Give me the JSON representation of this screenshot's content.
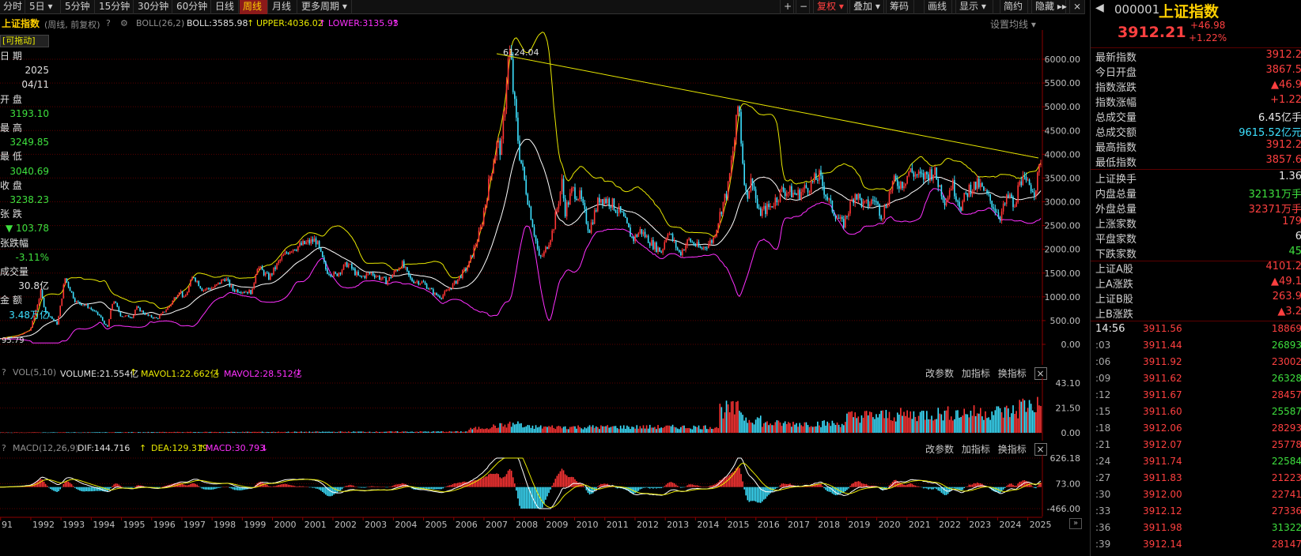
{
  "toolbar": {
    "periods": [
      "分时",
      "5日 ▾",
      "5分钟",
      "15分钟",
      "30分钟",
      "60分钟",
      "日线",
      "周线",
      "月线",
      "更多周期 ▾"
    ],
    "active_period": "周线",
    "right_buttons": [
      "+",
      "−",
      "复权 ▾",
      "叠加 ▾",
      "筹码",
      "画线",
      "显示 ▾",
      "简约",
      "隐藏 ▸▸"
    ]
  },
  "chart_header": {
    "title": "上证指数",
    "subtitle": "(周线, 前复权)",
    "indicator": "BOLL(26,2)",
    "boll": "BOLL:3585.98",
    "upper": "UPPER:4036.02",
    "lower": "LOWER:3135.93",
    "settings": "设置均线 ▾"
  },
  "info_panel": {
    "badge": "[可拖动]",
    "date_label": "日 期",
    "year": "2025",
    "date": "04/11",
    "open_label": "开 盘",
    "open": "3193.10",
    "high_label": "最 高",
    "high": "3249.85",
    "low_label": "最 低",
    "low": "3040.69",
    "close_label": "收 盘",
    "close": "3238.23",
    "change_label": "张 跌",
    "change": "▼ 103.78",
    "pct_label": "张跌幅",
    "pct": "-3.11%",
    "vol_label": "成交量",
    "vol": "30.8亿",
    "amt_label": "金 额",
    "amt": "3.48万亿"
  },
  "price_axis": [
    "6000.00",
    "5500.00",
    "5000.00",
    "4500.00",
    "4000.00",
    "3500.00",
    "3000.00",
    "2500.00",
    "2000.00",
    "1500.00",
    "1000.00",
    "500.00",
    "0.00"
  ],
  "annotations": {
    "peak": "6124.04",
    "start": "95.79"
  },
  "vol_panel": {
    "indicator": "VOL(5,10)",
    "volume": "VOLUME:21.554亿",
    "mavol1": "MAVOL1:22.662亿",
    "mavol2": "MAVOL2:28.512亿",
    "axis": [
      "43.10",
      "21.50",
      "0.00"
    ],
    "tools": [
      "改参数",
      "加指标",
      "换指标"
    ]
  },
  "macd_panel": {
    "indicator": "MACD(12,26,9)",
    "dif": "DIF:144.716",
    "dea": "DEA:129.319",
    "macd": "MACD:30.793",
    "axis": [
      "626.18",
      "73.00",
      "-466.00"
    ],
    "tools": [
      "改参数",
      "加指标",
      "换指标"
    ]
  },
  "years": [
    "91",
    "1992",
    "1993",
    "1994",
    "1995",
    "1996",
    "1997",
    "1998",
    "1999",
    "2000",
    "2001",
    "2002",
    "2003",
    "2004",
    "2005",
    "2006",
    "2007",
    "2008",
    "2009",
    "2010",
    "2011",
    "2012",
    "2013",
    "2014",
    "2015",
    "2016",
    "2017",
    "2018",
    "2019",
    "2020",
    "2021",
    "2022",
    "2023",
    "2024",
    "2025"
  ],
  "quote": {
    "code": "000001",
    "name": "上证指数",
    "price": "3912.21",
    "change": "+46.98",
    "pct": "+1.22%",
    "stats": [
      {
        "k": "最新指数",
        "v": "3912.2",
        "c": "red"
      },
      {
        "k": "今日开盘",
        "v": "3867.5",
        "c": "red"
      },
      {
        "k": "指数涨跌",
        "v": "▲46.9",
        "c": "red"
      },
      {
        "k": "指数涨幅",
        "v": "+1.22",
        "c": "red"
      },
      {
        "k": "总成交量",
        "v": "6.45亿手",
        "c": "white"
      },
      {
        "k": "总成交额",
        "v": "9615.52亿元",
        "c": "cyan"
      },
      {
        "k": "最高指数",
        "v": "3912.2",
        "c": "red"
      },
      {
        "k": "最低指数",
        "v": "3857.6",
        "c": "red"
      },
      {
        "k": "上证换手",
        "v": "1.36",
        "c": "white"
      },
      {
        "k": "内盘总量",
        "v": "32131万手",
        "c": "green"
      },
      {
        "k": "外盘总量",
        "v": "32371万手",
        "c": "red"
      },
      {
        "k": "上涨家数",
        "v": "179",
        "c": "red"
      },
      {
        "k": "平盘家数",
        "v": "6",
        "c": "white"
      },
      {
        "k": "下跌家数",
        "v": "45",
        "c": "green"
      },
      {
        "k": "上证A股",
        "v": "4101.2",
        "c": "red"
      },
      {
        "k": "上A涨跌",
        "v": "▲49.1",
        "c": "red"
      },
      {
        "k": "上证B股",
        "v": "263.9",
        "c": "red"
      },
      {
        "k": "上B涨跌",
        "v": "▲3.2",
        "c": "red"
      }
    ],
    "ticks": [
      {
        "t": "14:56",
        "p": "3911.56",
        "q": "18869",
        "c": "red"
      },
      {
        "t": ":03",
        "p": "3911.44",
        "q": "26893",
        "c": "green"
      },
      {
        "t": ":06",
        "p": "3911.92",
        "q": "23002",
        "c": "red"
      },
      {
        "t": ":09",
        "p": "3911.62",
        "q": "26328",
        "c": "green"
      },
      {
        "t": ":12",
        "p": "3911.67",
        "q": "28457",
        "c": "red"
      },
      {
        "t": ":15",
        "p": "3911.60",
        "q": "25587",
        "c": "green"
      },
      {
        "t": ":18",
        "p": "3912.06",
        "q": "28293",
        "c": "red"
      },
      {
        "t": ":21",
        "p": "3912.07",
        "q": "25778",
        "c": "red"
      },
      {
        "t": ":24",
        "p": "3911.74",
        "q": "22584",
        "c": "green"
      },
      {
        "t": ":27",
        "p": "3911.83",
        "q": "21223",
        "c": "red"
      },
      {
        "t": ":30",
        "p": "3912.00",
        "q": "22741",
        "c": "red"
      },
      {
        "t": ":33",
        "p": "3912.12",
        "q": "27336",
        "c": "red"
      },
      {
        "t": ":36",
        "p": "3911.98",
        "q": "31322",
        "c": "green"
      },
      {
        "t": ":39",
        "p": "3912.14",
        "q": "28147",
        "c": "red"
      }
    ]
  },
  "colors": {
    "up": "#ff3535",
    "down": "#3de0ff",
    "boll_mid": "#ffffff",
    "boll_upper": "#e8e800",
    "boll_lower": "#ff30ff",
    "grid": "#5a0000"
  }
}
